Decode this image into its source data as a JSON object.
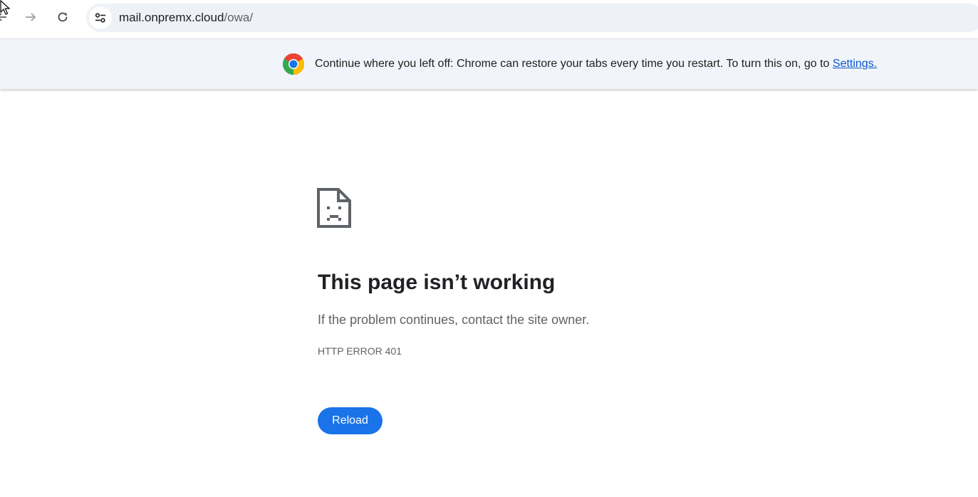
{
  "browser": {
    "url_host": "mail.onpremx.cloud",
    "url_path": "/owa/",
    "icons": {
      "back": "arrow-back-icon",
      "forward": "arrow-forward-icon",
      "reload": "reload-icon",
      "site_info": "tune-icon"
    }
  },
  "infobar": {
    "message": "Continue where you left off: Chrome can restore your tabs every time you restart. To turn this on, go to ",
    "link_label": "Settings.",
    "icon": "chrome-logo-icon"
  },
  "error": {
    "title": "This page isn’t working",
    "message": "If the problem continues, contact the site owner.",
    "code": "HTTP ERROR 401",
    "reload_label": "Reload",
    "icon": "sad-page-icon"
  },
  "colors": {
    "accent": "#1a73e8",
    "link": "#0b57d0",
    "infobar_bg": "#f1f4fa",
    "omnibox_bg": "#eef1f8"
  }
}
